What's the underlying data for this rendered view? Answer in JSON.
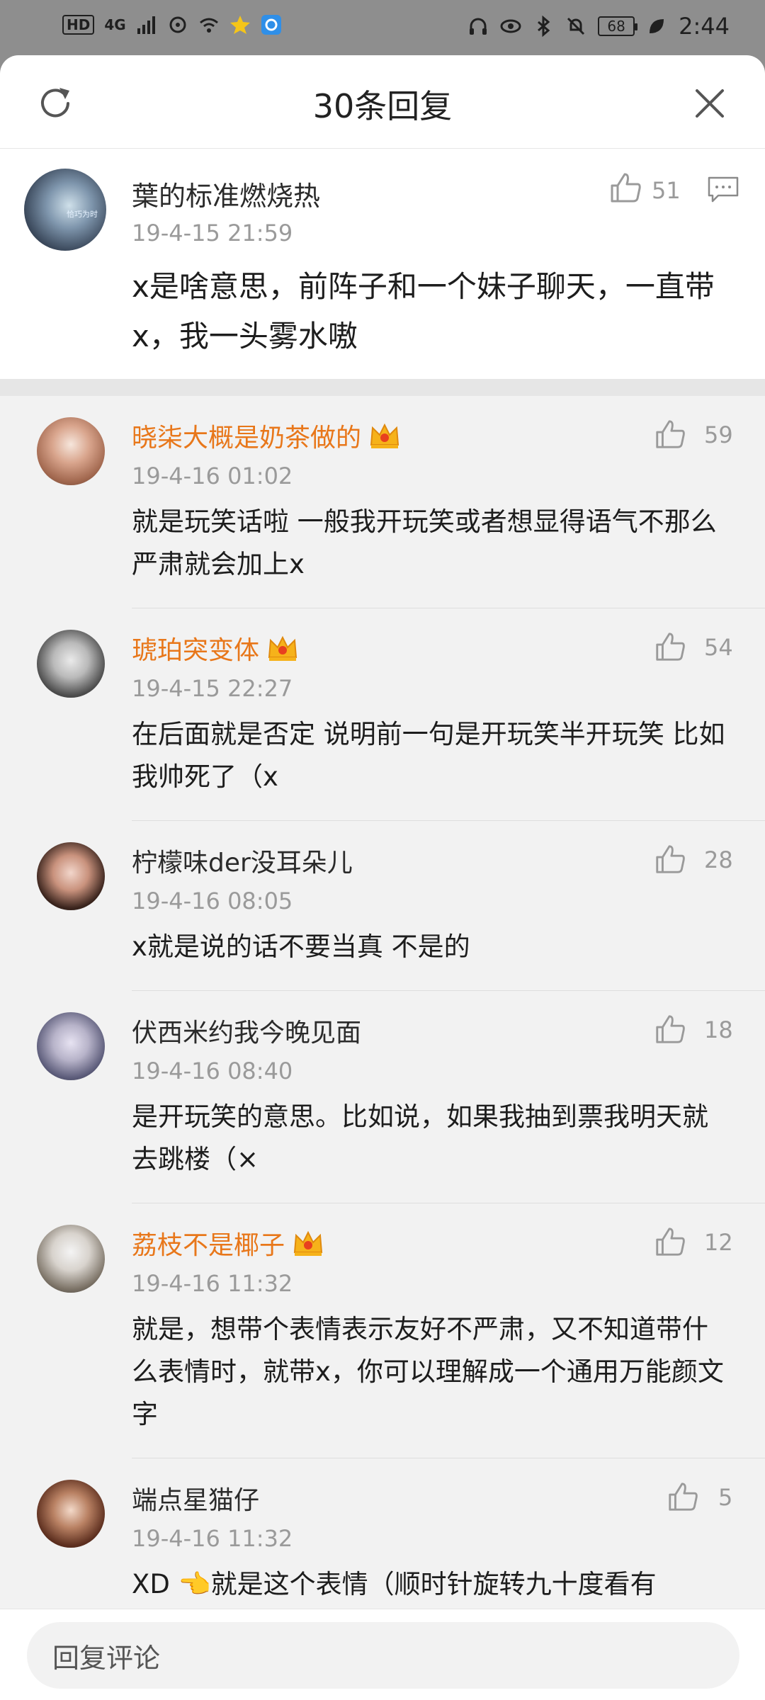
{
  "status_bar": {
    "hd": "HD",
    "network": "4G",
    "battery": "68",
    "time": "2:44"
  },
  "header": {
    "title": "30条回复"
  },
  "main_comment": {
    "username": "葉的标准燃烧热",
    "time": "19-4-15 21:59",
    "likes": "51",
    "body": "x是啥意思，前阵子和一个妹子聊天，一直带x，我一头雾水嗷",
    "avatar_tag": "恰巧为时"
  },
  "replies": [
    {
      "username": "晓柒大概是奶茶做的",
      "vip": true,
      "time": "19-4-16 01:02",
      "likes": "59",
      "body": "就是玩笑话啦 一般我开玩笑或者想显得语气不那么严肃就会加上x"
    },
    {
      "username": "琥珀突变体",
      "vip": true,
      "time": "19-4-15 22:27",
      "likes": "54",
      "body": "在后面就是否定 说明前一句是开玩笑半开玩笑 比如 我帅死了（x"
    },
    {
      "username": "柠檬味der没耳朵儿",
      "vip": false,
      "time": "19-4-16 08:05",
      "likes": "28",
      "body": "x就是说的话不要当真 不是的"
    },
    {
      "username": "伏西米约我今晚见面",
      "vip": false,
      "time": "19-4-16 08:40",
      "likes": "18",
      "body": "是开玩笑的意思。比如说，如果我抽到票我明天就去跳楼（×"
    },
    {
      "username": "荔枝不是椰子",
      "vip": true,
      "time": "19-4-16 11:32",
      "likes": "12",
      "body": "就是，想带个表情表示友好不严肃，又不知道带什么表情时，就带x，你可以理解成一个通用万能颜文字"
    },
    {
      "username": "端点星猫仔",
      "vip": false,
      "time": "19-4-16 11:32",
      "likes": "5",
      "body": "XD 👈就是这个表情（顺时针旋转九十度看有"
    }
  ],
  "bottom": {
    "placeholder": "回复评论"
  },
  "colors": {
    "vip_name": "#e8771a",
    "muted": "#9a9a9a",
    "list_bg": "#f2f2f2"
  }
}
